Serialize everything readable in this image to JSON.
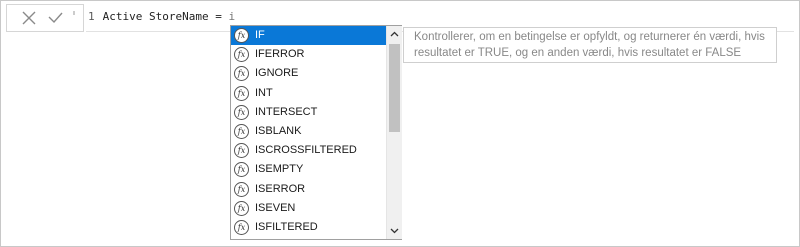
{
  "toolbar": {
    "cancel_icon": "close-icon",
    "commit_icon": "checkmark-icon"
  },
  "editor": {
    "line_number": "1",
    "formula_text": "Active StoreName = ",
    "typed_text": "i"
  },
  "autocomplete": {
    "items": [
      {
        "label": "IF",
        "icon": "function-icon"
      },
      {
        "label": "IFERROR",
        "icon": "function-icon"
      },
      {
        "label": "IGNORE",
        "icon": "function-icon"
      },
      {
        "label": "INT",
        "icon": "function-icon"
      },
      {
        "label": "INTERSECT",
        "icon": "function-icon"
      },
      {
        "label": "ISBLANK",
        "icon": "function-icon"
      },
      {
        "label": "ISCROSSFILTERED",
        "icon": "function-icon"
      },
      {
        "label": "ISEMPTY",
        "icon": "function-icon"
      },
      {
        "label": "ISERROR",
        "icon": "function-icon"
      },
      {
        "label": "ISEVEN",
        "icon": "function-icon"
      },
      {
        "label": "ISFILTERED",
        "icon": "function-icon"
      }
    ],
    "fx_glyph": "fx",
    "selected_label": "IF",
    "selected_color": "#0a78d7"
  },
  "tooltip": {
    "text": "Kontrollerer, om en betingelse er opfyldt, og returnerer én værdi, hvis resultatet er TRUE, og en anden værdi, hvis resultatet er FALSE"
  }
}
